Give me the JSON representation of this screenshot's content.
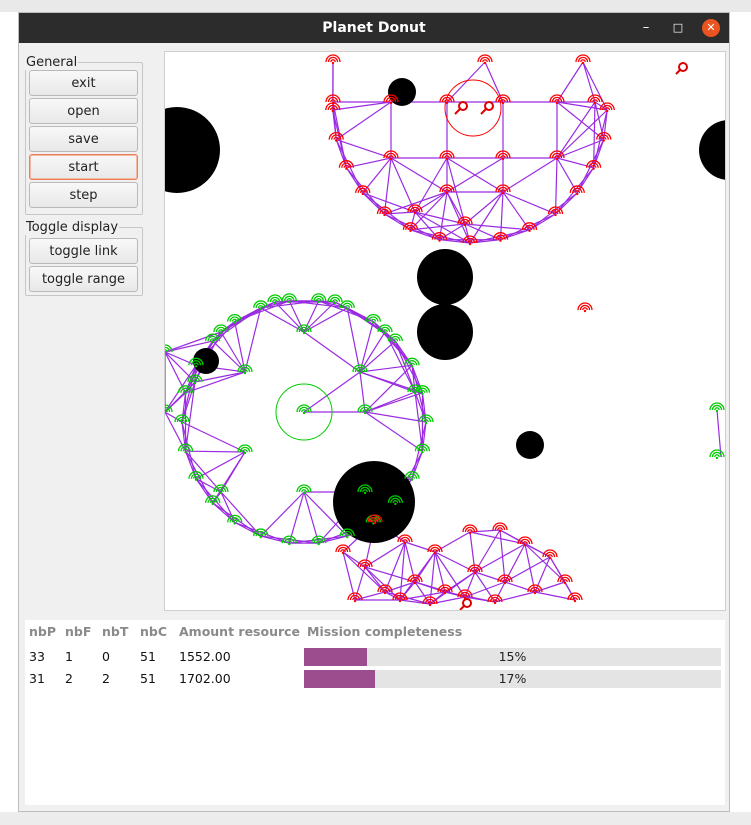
{
  "window": {
    "title": "Planet Donut",
    "controls": [
      "–",
      "□",
      "✕"
    ]
  },
  "sidebar": {
    "general": {
      "legend": "General",
      "buttons": {
        "exit": "exit",
        "open": "open",
        "save": "save",
        "start": "start",
        "step": "step"
      }
    },
    "toggle": {
      "legend": "Toggle display",
      "buttons": {
        "link": "toggle link",
        "range": "toggle range"
      }
    }
  },
  "colors": {
    "link": "#9a2be2",
    "base1": "#ff0000",
    "base2": "#00cc00",
    "obstacle": "#000000",
    "progress": "#9c4d8e"
  },
  "icons": [
    "robot-wifi-icon",
    "base-center-icon"
  ],
  "table": {
    "headers": [
      "nbP",
      "nbF",
      "nbT",
      "nbC",
      "Amount resource",
      "Mission completeness"
    ],
    "rows": [
      {
        "nbP": "33",
        "nbF": "1",
        "nbT": "0",
        "nbC": "51",
        "amount": "1552.00",
        "completeness": 0.15,
        "completeness_label": "15%"
      },
      {
        "nbP": "31",
        "nbF": "2",
        "nbT": "2",
        "nbC": "51",
        "amount": "1702.00",
        "completeness": 0.17,
        "completeness_label": "17%"
      }
    ]
  }
}
